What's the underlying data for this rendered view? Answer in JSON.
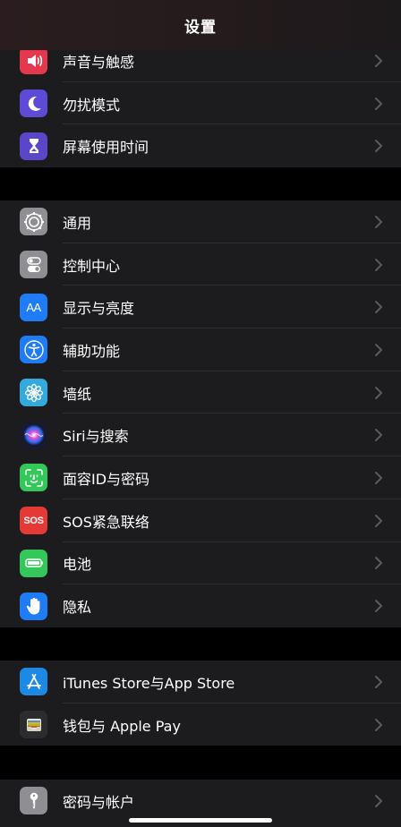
{
  "nav": {
    "title": "设置"
  },
  "group1": [
    {
      "id": "sounds",
      "label": "声音与触感",
      "icon": "speaker-icon",
      "color": "#e5384f"
    },
    {
      "id": "dnd",
      "label": "勿扰模式",
      "icon": "moon-icon",
      "color": "#5b4bd6"
    },
    {
      "id": "screentime",
      "label": "屏幕使用时间",
      "icon": "hourglass-icon",
      "color": "#5a46c8"
    }
  ],
  "group2": [
    {
      "id": "general",
      "label": "通用",
      "icon": "gear-icon",
      "color": "#8e8e93"
    },
    {
      "id": "control-center",
      "label": "控制中心",
      "icon": "toggles-icon",
      "color": "#8e8e93"
    },
    {
      "id": "display",
      "label": "显示与亮度",
      "icon": "text-size-icon",
      "color": "#1f7cf5",
      "icon_text": "AA"
    },
    {
      "id": "accessibility",
      "label": "辅助功能",
      "icon": "accessibility-icon",
      "color": "#1f7cf5"
    },
    {
      "id": "wallpaper",
      "label": "墙纸",
      "icon": "flower-icon",
      "color": "#34aadc"
    },
    {
      "id": "siri",
      "label": "Siri与搜索",
      "icon": "siri-icon",
      "color": "#1a1a2e"
    },
    {
      "id": "faceid",
      "label": "面容ID与密码",
      "icon": "faceid-icon",
      "color": "#34c759"
    },
    {
      "id": "sos",
      "label": "SOS紧急联络",
      "icon": "sos-icon",
      "color": "#e53935",
      "icon_text": "SOS"
    },
    {
      "id": "battery",
      "label": "电池",
      "icon": "battery-icon",
      "color": "#34c759"
    },
    {
      "id": "privacy",
      "label": "隐私",
      "icon": "hand-icon",
      "color": "#1f7cf5"
    }
  ],
  "group3": [
    {
      "id": "appstore",
      "label": "iTunes Store与App Store",
      "icon": "appstore-icon",
      "color": "#1e88e5"
    },
    {
      "id": "wallet",
      "label": "钱包与 Apple Pay",
      "icon": "wallet-icon",
      "color": "#2c2c2e"
    }
  ],
  "group4": [
    {
      "id": "passwords",
      "label": "密码与帐户",
      "icon": "key-icon",
      "color": "#8e8e93"
    }
  ]
}
